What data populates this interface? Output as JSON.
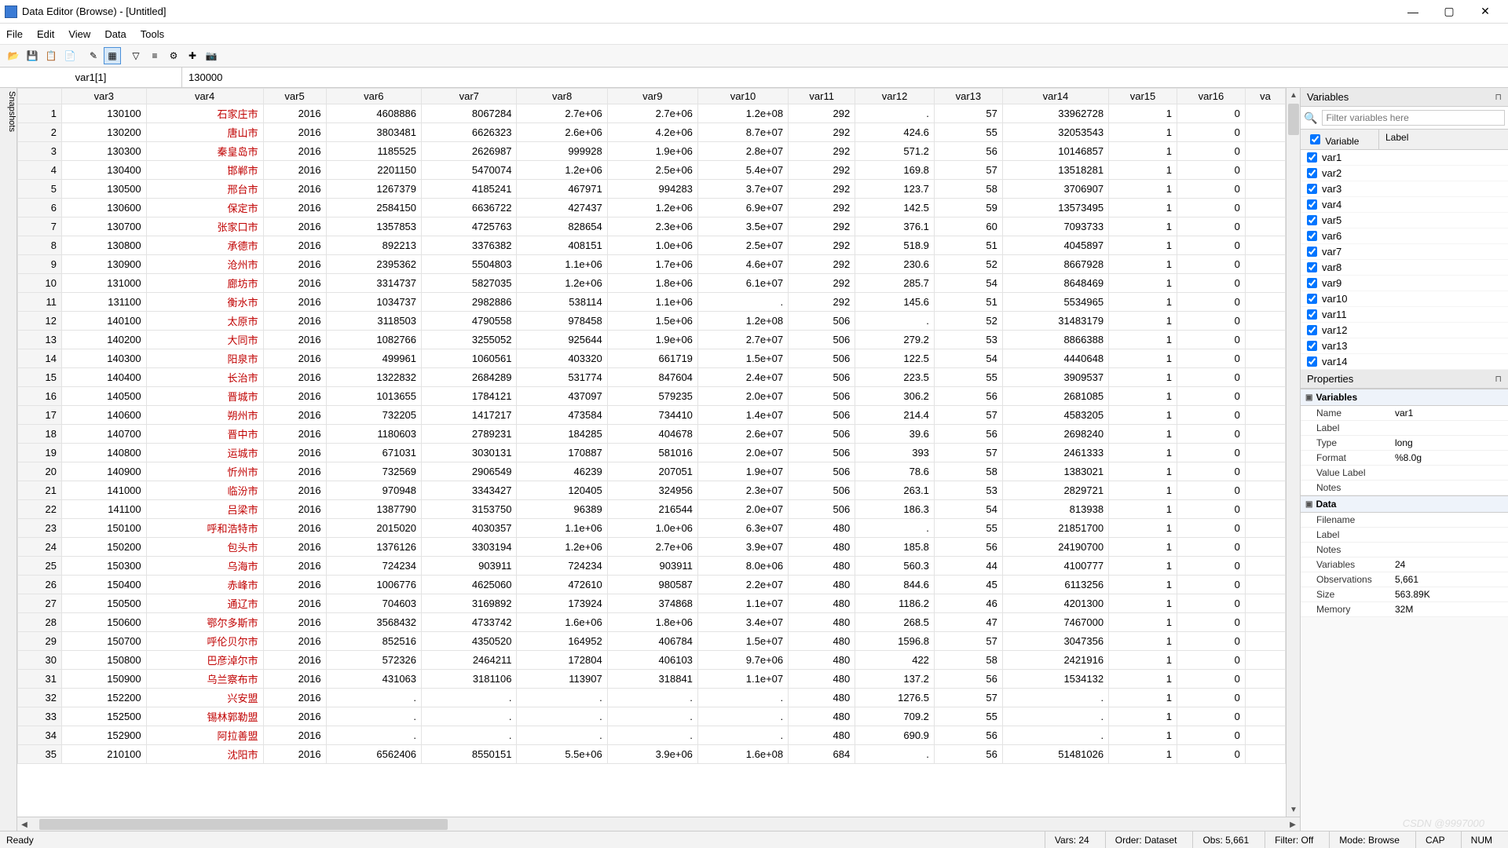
{
  "title": "Data Editor (Browse) - [Untitled]",
  "menus": [
    "File",
    "Edit",
    "View",
    "Data",
    "Tools"
  ],
  "toolbar_icons": [
    "open-icon",
    "save-icon",
    "copy-icon",
    "paste-icon",
    "edit-mode-icon",
    "browse-mode-icon",
    "filter-icon",
    "variables-icon",
    "properties-icon",
    "snapshot-icon",
    "camera-icon"
  ],
  "inspect": {
    "cell": "var1[1]",
    "value": "130000"
  },
  "columns": [
    "",
    "var3",
    "var4",
    "var5",
    "var6",
    "var7",
    "var8",
    "var9",
    "var10",
    "var11",
    "var12",
    "var13",
    "var14",
    "var15",
    "var16",
    "va"
  ],
  "rows": [
    {
      "n": 1,
      "var3": "130100",
      "var4": "石家庄市",
      "var5": "2016",
      "var6": "4608886",
      "var7": "8067284",
      "var8": "2.7e+06",
      "var9": "2.7e+06",
      "var10": "1.2e+08",
      "var11": "292",
      "var12": ".",
      "var13": "57",
      "var14": "33962728",
      "var15": "1",
      "var16": "0"
    },
    {
      "n": 2,
      "var3": "130200",
      "var4": "唐山市",
      "var5": "2016",
      "var6": "3803481",
      "var7": "6626323",
      "var8": "2.6e+06",
      "var9": "4.2e+06",
      "var10": "8.7e+07",
      "var11": "292",
      "var12": "424.6",
      "var13": "55",
      "var14": "32053543",
      "var15": "1",
      "var16": "0"
    },
    {
      "n": 3,
      "var3": "130300",
      "var4": "秦皇岛市",
      "var5": "2016",
      "var6": "1185525",
      "var7": "2626987",
      "var8": "999928",
      "var9": "1.9e+06",
      "var10": "2.8e+07",
      "var11": "292",
      "var12": "571.2",
      "var13": "56",
      "var14": "10146857",
      "var15": "1",
      "var16": "0"
    },
    {
      "n": 4,
      "var3": "130400",
      "var4": "邯郸市",
      "var5": "2016",
      "var6": "2201150",
      "var7": "5470074",
      "var8": "1.2e+06",
      "var9": "2.5e+06",
      "var10": "5.4e+07",
      "var11": "292",
      "var12": "169.8",
      "var13": "57",
      "var14": "13518281",
      "var15": "1",
      "var16": "0"
    },
    {
      "n": 5,
      "var3": "130500",
      "var4": "邢台市",
      "var5": "2016",
      "var6": "1267379",
      "var7": "4185241",
      "var8": "467971",
      "var9": "994283",
      "var10": "3.7e+07",
      "var11": "292",
      "var12": "123.7",
      "var13": "58",
      "var14": "3706907",
      "var15": "1",
      "var16": "0"
    },
    {
      "n": 6,
      "var3": "130600",
      "var4": "保定市",
      "var5": "2016",
      "var6": "2584150",
      "var7": "6636722",
      "var8": "427437",
      "var9": "1.2e+06",
      "var10": "6.9e+07",
      "var11": "292",
      "var12": "142.5",
      "var13": "59",
      "var14": "13573495",
      "var15": "1",
      "var16": "0"
    },
    {
      "n": 7,
      "var3": "130700",
      "var4": "张家口市",
      "var5": "2016",
      "var6": "1357853",
      "var7": "4725763",
      "var8": "828654",
      "var9": "2.3e+06",
      "var10": "3.5e+07",
      "var11": "292",
      "var12": "376.1",
      "var13": "60",
      "var14": "7093733",
      "var15": "1",
      "var16": "0"
    },
    {
      "n": 8,
      "var3": "130800",
      "var4": "承德市",
      "var5": "2016",
      "var6": "892213",
      "var7": "3376382",
      "var8": "408151",
      "var9": "1.0e+06",
      "var10": "2.5e+07",
      "var11": "292",
      "var12": "518.9",
      "var13": "51",
      "var14": "4045897",
      "var15": "1",
      "var16": "0"
    },
    {
      "n": 9,
      "var3": "130900",
      "var4": "沧州市",
      "var5": "2016",
      "var6": "2395362",
      "var7": "5504803",
      "var8": "1.1e+06",
      "var9": "1.7e+06",
      "var10": "4.6e+07",
      "var11": "292",
      "var12": "230.6",
      "var13": "52",
      "var14": "8667928",
      "var15": "1",
      "var16": "0"
    },
    {
      "n": 10,
      "var3": "131000",
      "var4": "廊坊市",
      "var5": "2016",
      "var6": "3314737",
      "var7": "5827035",
      "var8": "1.2e+06",
      "var9": "1.8e+06",
      "var10": "6.1e+07",
      "var11": "292",
      "var12": "285.7",
      "var13": "54",
      "var14": "8648469",
      "var15": "1",
      "var16": "0"
    },
    {
      "n": 11,
      "var3": "131100",
      "var4": "衡水市",
      "var5": "2016",
      "var6": "1034737",
      "var7": "2982886",
      "var8": "538114",
      "var9": "1.1e+06",
      "var10": ".",
      "var11": "292",
      "var12": "145.6",
      "var13": "51",
      "var14": "5534965",
      "var15": "1",
      "var16": "0"
    },
    {
      "n": 12,
      "var3": "140100",
      "var4": "太原市",
      "var5": "2016",
      "var6": "3118503",
      "var7": "4790558",
      "var8": "978458",
      "var9": "1.5e+06",
      "var10": "1.2e+08",
      "var11": "506",
      "var12": ".",
      "var13": "52",
      "var14": "31483179",
      "var15": "1",
      "var16": "0"
    },
    {
      "n": 13,
      "var3": "140200",
      "var4": "大同市",
      "var5": "2016",
      "var6": "1082766",
      "var7": "3255052",
      "var8": "925644",
      "var9": "1.9e+06",
      "var10": "2.7e+07",
      "var11": "506",
      "var12": "279.2",
      "var13": "53",
      "var14": "8866388",
      "var15": "1",
      "var16": "0"
    },
    {
      "n": 14,
      "var3": "140300",
      "var4": "阳泉市",
      "var5": "2016",
      "var6": "499961",
      "var7": "1060561",
      "var8": "403320",
      "var9": "661719",
      "var10": "1.5e+07",
      "var11": "506",
      "var12": "122.5",
      "var13": "54",
      "var14": "4440648",
      "var15": "1",
      "var16": "0"
    },
    {
      "n": 15,
      "var3": "140400",
      "var4": "长治市",
      "var5": "2016",
      "var6": "1322832",
      "var7": "2684289",
      "var8": "531774",
      "var9": "847604",
      "var10": "2.4e+07",
      "var11": "506",
      "var12": "223.5",
      "var13": "55",
      "var14": "3909537",
      "var15": "1",
      "var16": "0"
    },
    {
      "n": 16,
      "var3": "140500",
      "var4": "晋城市",
      "var5": "2016",
      "var6": "1013655",
      "var7": "1784121",
      "var8": "437097",
      "var9": "579235",
      "var10": "2.0e+07",
      "var11": "506",
      "var12": "306.2",
      "var13": "56",
      "var14": "2681085",
      "var15": "1",
      "var16": "0"
    },
    {
      "n": 17,
      "var3": "140600",
      "var4": "朔州市",
      "var5": "2016",
      "var6": "732205",
      "var7": "1417217",
      "var8": "473584",
      "var9": "734410",
      "var10": "1.4e+07",
      "var11": "506",
      "var12": "214.4",
      "var13": "57",
      "var14": "4583205",
      "var15": "1",
      "var16": "0"
    },
    {
      "n": 18,
      "var3": "140700",
      "var4": "晋中市",
      "var5": "2016",
      "var6": "1180603",
      "var7": "2789231",
      "var8": "184285",
      "var9": "404678",
      "var10": "2.6e+07",
      "var11": "506",
      "var12": "39.6",
      "var13": "56",
      "var14": "2698240",
      "var15": "1",
      "var16": "0"
    },
    {
      "n": 19,
      "var3": "140800",
      "var4": "运城市",
      "var5": "2016",
      "var6": "671031",
      "var7": "3030131",
      "var8": "170887",
      "var9": "581016",
      "var10": "2.0e+07",
      "var11": "506",
      "var12": "393",
      "var13": "57",
      "var14": "2461333",
      "var15": "1",
      "var16": "0"
    },
    {
      "n": 20,
      "var3": "140900",
      "var4": "忻州市",
      "var5": "2016",
      "var6": "732569",
      "var7": "2906549",
      "var8": "46239",
      "var9": "207051",
      "var10": "1.9e+07",
      "var11": "506",
      "var12": "78.6",
      "var13": "58",
      "var14": "1383021",
      "var15": "1",
      "var16": "0"
    },
    {
      "n": 21,
      "var3": "141000",
      "var4": "临汾市",
      "var5": "2016",
      "var6": "970948",
      "var7": "3343427",
      "var8": "120405",
      "var9": "324956",
      "var10": "2.3e+07",
      "var11": "506",
      "var12": "263.1",
      "var13": "53",
      "var14": "2829721",
      "var15": "1",
      "var16": "0"
    },
    {
      "n": 22,
      "var3": "141100",
      "var4": "吕梁市",
      "var5": "2016",
      "var6": "1387790",
      "var7": "3153750",
      "var8": "96389",
      "var9": "216544",
      "var10": "2.0e+07",
      "var11": "506",
      "var12": "186.3",
      "var13": "54",
      "var14": "813938",
      "var15": "1",
      "var16": "0"
    },
    {
      "n": 23,
      "var3": "150100",
      "var4": "呼和浩特市",
      "var5": "2016",
      "var6": "2015020",
      "var7": "4030357",
      "var8": "1.1e+06",
      "var9": "1.0e+06",
      "var10": "6.3e+07",
      "var11": "480",
      "var12": ".",
      "var13": "55",
      "var14": "21851700",
      "var15": "1",
      "var16": "0"
    },
    {
      "n": 24,
      "var3": "150200",
      "var4": "包头市",
      "var5": "2016",
      "var6": "1376126",
      "var7": "3303194",
      "var8": "1.2e+06",
      "var9": "2.7e+06",
      "var10": "3.9e+07",
      "var11": "480",
      "var12": "185.8",
      "var13": "56",
      "var14": "24190700",
      "var15": "1",
      "var16": "0"
    },
    {
      "n": 25,
      "var3": "150300",
      "var4": "乌海市",
      "var5": "2016",
      "var6": "724234",
      "var7": "903911",
      "var8": "724234",
      "var9": "903911",
      "var10": "8.0e+06",
      "var11": "480",
      "var12": "560.3",
      "var13": "44",
      "var14": "4100777",
      "var15": "1",
      "var16": "0"
    },
    {
      "n": 26,
      "var3": "150400",
      "var4": "赤峰市",
      "var5": "2016",
      "var6": "1006776",
      "var7": "4625060",
      "var8": "472610",
      "var9": "980587",
      "var10": "2.2e+07",
      "var11": "480",
      "var12": "844.6",
      "var13": "45",
      "var14": "6113256",
      "var15": "1",
      "var16": "0"
    },
    {
      "n": 27,
      "var3": "150500",
      "var4": "通辽市",
      "var5": "2016",
      "var6": "704603",
      "var7": "3169892",
      "var8": "173924",
      "var9": "374868",
      "var10": "1.1e+07",
      "var11": "480",
      "var12": "1186.2",
      "var13": "46",
      "var14": "4201300",
      "var15": "1",
      "var16": "0"
    },
    {
      "n": 28,
      "var3": "150600",
      "var4": "鄂尔多斯市",
      "var5": "2016",
      "var6": "3568432",
      "var7": "4733742",
      "var8": "1.6e+06",
      "var9": "1.8e+06",
      "var10": "3.4e+07",
      "var11": "480",
      "var12": "268.5",
      "var13": "47",
      "var14": "7467000",
      "var15": "1",
      "var16": "0"
    },
    {
      "n": 29,
      "var3": "150700",
      "var4": "呼伦贝尔市",
      "var5": "2016",
      "var6": "852516",
      "var7": "4350520",
      "var8": "164952",
      "var9": "406784",
      "var10": "1.5e+07",
      "var11": "480",
      "var12": "1596.8",
      "var13": "57",
      "var14": "3047356",
      "var15": "1",
      "var16": "0"
    },
    {
      "n": 30,
      "var3": "150800",
      "var4": "巴彦淖尔市",
      "var5": "2016",
      "var6": "572326",
      "var7": "2464211",
      "var8": "172804",
      "var9": "406103",
      "var10": "9.7e+06",
      "var11": "480",
      "var12": "422",
      "var13": "58",
      "var14": "2421916",
      "var15": "1",
      "var16": "0"
    },
    {
      "n": 31,
      "var3": "150900",
      "var4": "乌兰察布市",
      "var5": "2016",
      "var6": "431063",
      "var7": "3181106",
      "var8": "113907",
      "var9": "318841",
      "var10": "1.1e+07",
      "var11": "480",
      "var12": "137.2",
      "var13": "56",
      "var14": "1534132",
      "var15": "1",
      "var16": "0"
    },
    {
      "n": 32,
      "var3": "152200",
      "var4": "兴安盟",
      "var5": "2016",
      "var6": ".",
      "var7": ".",
      "var8": ".",
      "var9": ".",
      "var10": ".",
      "var11": "480",
      "var12": "1276.5",
      "var13": "57",
      "var14": ".",
      "var15": "1",
      "var16": "0"
    },
    {
      "n": 33,
      "var3": "152500",
      "var4": "锡林郭勒盟",
      "var5": "2016",
      "var6": ".",
      "var7": ".",
      "var8": ".",
      "var9": ".",
      "var10": ".",
      "var11": "480",
      "var12": "709.2",
      "var13": "55",
      "var14": ".",
      "var15": "1",
      "var16": "0"
    },
    {
      "n": 34,
      "var3": "152900",
      "var4": "阿拉善盟",
      "var5": "2016",
      "var6": ".",
      "var7": ".",
      "var8": ".",
      "var9": ".",
      "var10": ".",
      "var11": "480",
      "var12": "690.9",
      "var13": "56",
      "var14": ".",
      "var15": "1",
      "var16": "0"
    },
    {
      "n": 35,
      "var3": "210100",
      "var4": "沈阳市",
      "var5": "2016",
      "var6": "6562406",
      "var7": "8550151",
      "var8": "5.5e+06",
      "var9": "3.9e+06",
      "var10": "1.6e+08",
      "var11": "684",
      "var12": ".",
      "var13": "56",
      "var14": "51481026",
      "var15": "1",
      "var16": "0"
    }
  ],
  "variables_panel": {
    "title": "Variables",
    "filter_placeholder": "Filter variables here",
    "col_variable": "Variable",
    "col_label": "Label",
    "items": [
      "var1",
      "var2",
      "var3",
      "var4",
      "var5",
      "var6",
      "var7",
      "var8",
      "var9",
      "var10",
      "var11",
      "var12",
      "var13",
      "var14"
    ]
  },
  "properties_panel": {
    "title": "Properties",
    "sections": {
      "variables": {
        "label": "Variables",
        "rows": [
          {
            "k": "Name",
            "v": "var1"
          },
          {
            "k": "Label",
            "v": ""
          },
          {
            "k": "Type",
            "v": "long"
          },
          {
            "k": "Format",
            "v": "%8.0g"
          },
          {
            "k": "Value Label",
            "v": ""
          },
          {
            "k": "Notes",
            "v": ""
          }
        ]
      },
      "data": {
        "label": "Data",
        "rows": [
          {
            "k": "Filename",
            "v": ""
          },
          {
            "k": "Label",
            "v": ""
          },
          {
            "k": "Notes",
            "v": ""
          },
          {
            "k": "Variables",
            "v": "24"
          },
          {
            "k": "Observations",
            "v": "5,661"
          },
          {
            "k": "Size",
            "v": "563.89K"
          },
          {
            "k": "Memory",
            "v": "32M"
          }
        ]
      }
    }
  },
  "status": {
    "ready": "Ready",
    "vars": "Vars: 24",
    "order": "Order: Dataset",
    "obs": "Obs: 5,661",
    "filter": "Filter: Off",
    "mode": "Mode: Browse",
    "cap": "CAP",
    "num": "NUM"
  },
  "snapshots_label": "Snapshots",
  "watermark": "CSDN @9997000"
}
